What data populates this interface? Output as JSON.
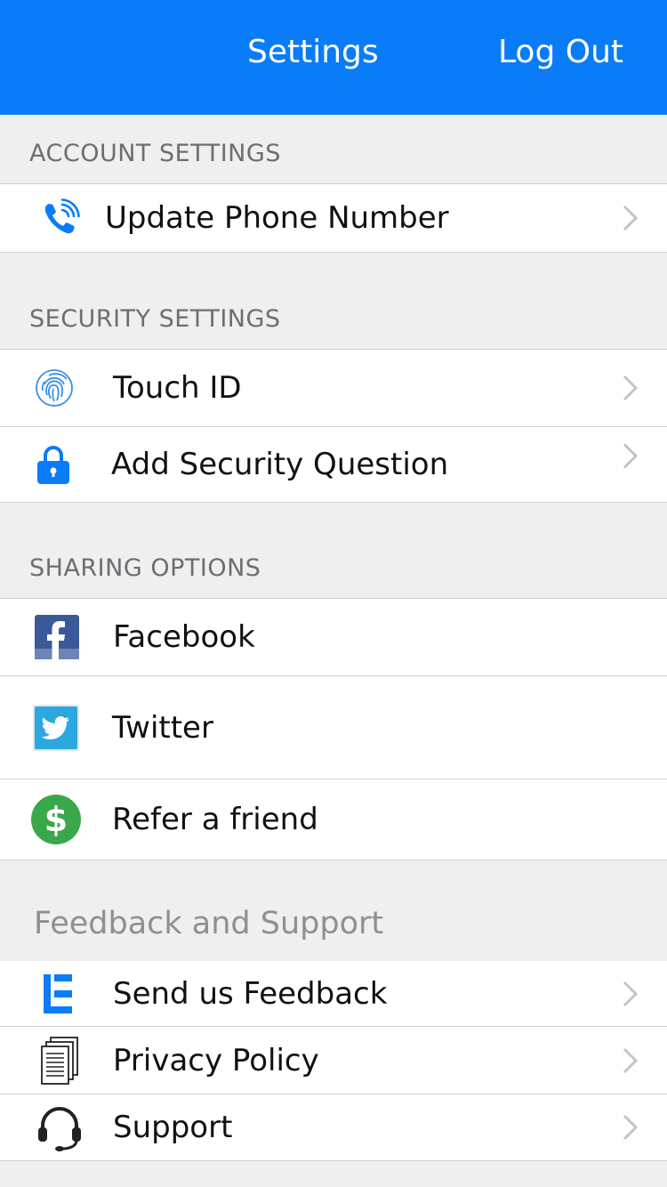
{
  "nav": {
    "title": "Settings",
    "logout_label": "Log Out"
  },
  "sections": {
    "account": {
      "header": "ACCOUNT SETTINGS",
      "items": [
        {
          "label": "Update Phone Number",
          "icon": "phone-icon"
        }
      ]
    },
    "security": {
      "header": "SECURITY SETTINGS",
      "items": [
        {
          "label": "Touch ID",
          "icon": "fingerprint-icon"
        },
        {
          "label": "Add Security Question",
          "icon": "lock-icon"
        }
      ]
    },
    "sharing": {
      "header": "SHARING OPTIONS",
      "items": [
        {
          "label": "Facebook",
          "icon": "facebook-icon"
        },
        {
          "label": "Twitter",
          "icon": "twitter-icon"
        },
        {
          "label": "Refer a friend",
          "icon": "dollar-icon"
        }
      ]
    },
    "support": {
      "header": "Feedback and Support",
      "items": [
        {
          "label": "Send us Feedback",
          "icon": "feedback-logo-icon"
        },
        {
          "label": "Privacy Policy",
          "icon": "document-icon"
        },
        {
          "label": "Support",
          "icon": "headset-icon"
        }
      ]
    }
  },
  "colors": {
    "nav_blue": "#0a7cf7",
    "icon_blue": "#0a7cf7",
    "facebook_blue": "#3b5998",
    "twitter_blue": "#2ca7e0",
    "refer_green": "#3aa84a",
    "group_background": "#efeff0"
  }
}
